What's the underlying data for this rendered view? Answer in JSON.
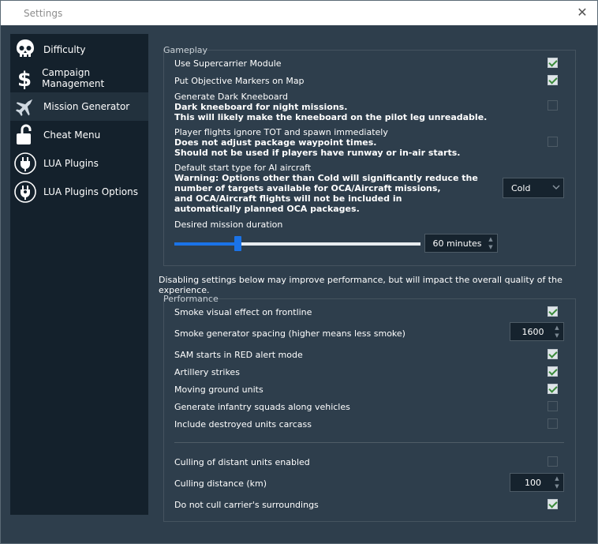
{
  "window": {
    "title": "Settings",
    "close_glyph": "✕"
  },
  "sidebar": {
    "items": [
      {
        "label": "Difficulty",
        "icon": "skull-icon"
      },
      {
        "label": "Campaign Management",
        "icon": "dollar-icon"
      },
      {
        "label": "Mission Generator",
        "icon": "jet-icon"
      },
      {
        "label": "Cheat Menu",
        "icon": "unlock-icon"
      },
      {
        "label": "LUA Plugins",
        "icon": "plug-icon"
      },
      {
        "label": "LUA Plugins Options",
        "icon": "plug-settings-icon"
      }
    ],
    "active": "Mission Generator"
  },
  "gameplay": {
    "title": "Gameplay",
    "supercarrier": {
      "label": "Use Supercarrier Module",
      "checked": true
    },
    "objective_markers": {
      "label": "Put Objective Markers on Map",
      "checked": true
    },
    "dark_kneeboard": {
      "label": "Generate Dark Kneeboard",
      "help1": "Dark kneeboard for night missions.",
      "help2": "This will likely make the kneeboard on the pilot leg unreadable.",
      "checked": false
    },
    "ignore_tot": {
      "label": "Player flights ignore TOT and spawn immediately",
      "help1": "Does not adjust package waypoint times.",
      "help2": "Should not be used if players have runway or in-air starts.",
      "checked": false
    },
    "start_type": {
      "label": "Default start type for AI aircraft",
      "warn1": "Warning: Options other than Cold will significantly reduce the",
      "warn2": "number of targets available for OCA/Aircraft missions,",
      "warn3": "and OCA/Aircraft flights will not be included in",
      "warn4": "automatically planned OCA packages.",
      "value": "Cold"
    },
    "duration": {
      "label": "Desired mission duration",
      "value": "60 minutes",
      "slider_fraction": 0.25
    }
  },
  "performance_note": "Disabling settings below may improve performance, but will impact the overall quality of the experience.",
  "performance": {
    "title": "Performance",
    "smoke": {
      "label": "Smoke visual effect on frontline",
      "checked": true
    },
    "smoke_spacing": {
      "label": "Smoke generator spacing (higher means less smoke)",
      "value": "1600"
    },
    "sam_red": {
      "label": "SAM starts in RED alert mode",
      "checked": true
    },
    "artillery": {
      "label": "Artillery strikes",
      "checked": true
    },
    "moving_units": {
      "label": "Moving ground units",
      "checked": true
    },
    "infantry": {
      "label": "Generate infantry squads along vehicles",
      "checked": false
    },
    "carcass": {
      "label": "Include destroyed units carcass",
      "checked": false
    },
    "culling": {
      "label": "Culling of distant units enabled",
      "checked": false
    },
    "culling_distance": {
      "label": "Culling distance (km)",
      "value": "100"
    },
    "carrier_cull": {
      "label": "Do not cull carrier's surroundings",
      "checked": true
    }
  },
  "colors": {
    "window_bg": "#2e3e4c",
    "sidebar_bg": "#14212c",
    "accent": "#1a73e8",
    "check_green": "#3a8a3a"
  }
}
